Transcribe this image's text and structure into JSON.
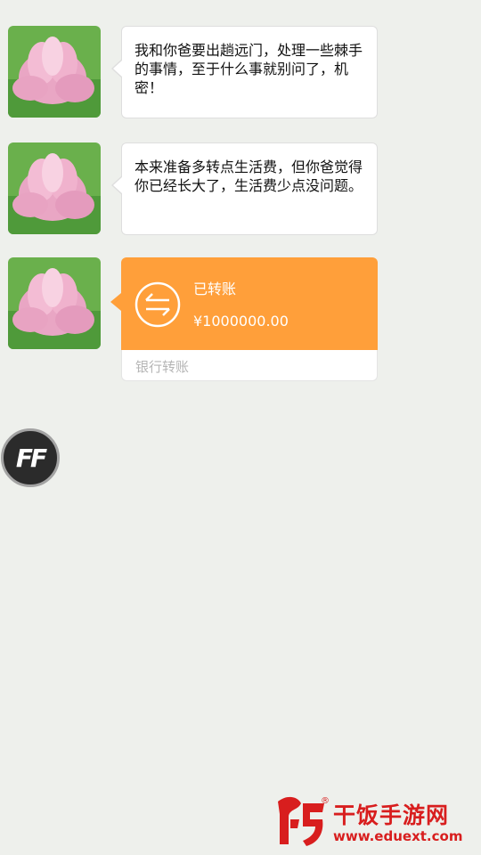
{
  "messages": [
    {
      "text": "我和你爸要出趟远门，处理一些棘手的事情，至于什么事就别问了，机密！"
    },
    {
      "text": "本来准备多转点生活费，但你爸觉得你已经长大了，生活费少点没问题。"
    }
  ],
  "transfer": {
    "status": "已转账",
    "amount": "¥1000000.00",
    "footer": "银行转账"
  },
  "floating_button": {
    "label": "FF"
  },
  "watermark": {
    "name": "干饭手游网",
    "url": "www.eduext.com",
    "registered": "®"
  },
  "colors": {
    "background": "#eef0ec",
    "transfer_orange": "#ff9f3a",
    "watermark_red": "#d81e1e"
  },
  "icons": {
    "avatar": "lotus-flower-avatar",
    "transfer": "transfer-arrows-icon"
  }
}
